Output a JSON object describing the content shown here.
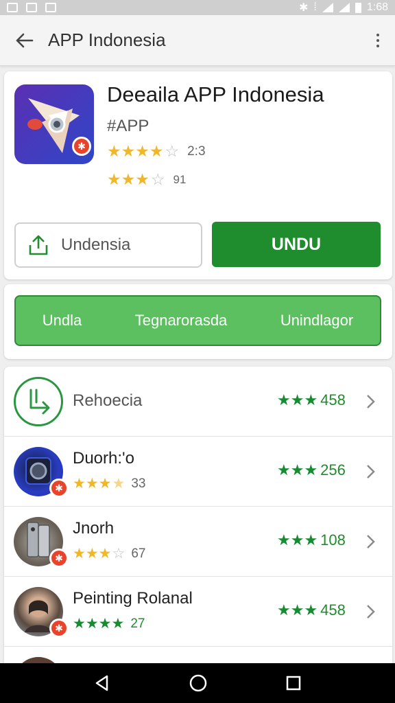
{
  "status_bar": {
    "time": "1:68"
  },
  "app_bar": {
    "title": "APP Indonesia"
  },
  "app": {
    "name": "Deeaila APP Indonesia",
    "subtitle": "#APP",
    "rating1": {
      "stars": "★★★★",
      "empty": "☆",
      "count": "2:3"
    },
    "rating2": {
      "stars": "★★★",
      "empty": "☆",
      "count": "91"
    },
    "secondary_button": "Undensia",
    "primary_button": "UNDU"
  },
  "tabs": [
    "Undla",
    "Tegnarorasda",
    "Unindlagor"
  ],
  "list": [
    {
      "name": "Rehoecia",
      "rating_stars": "★★★",
      "rating_value": "458"
    },
    {
      "name": "Duorh:'o",
      "sub_stars": "★★★",
      "sub_half": "★",
      "sub_empty": "",
      "sub_count": "33",
      "rating_stars": "★★★",
      "rating_value": "256"
    },
    {
      "name": "Jnorh",
      "sub_stars": "★★★",
      "sub_half": "",
      "sub_empty": "☆",
      "sub_count": "67",
      "rating_stars": "★★★",
      "rating_value": "108"
    },
    {
      "name": "Peinting Rolanal",
      "sub_stars": "★★★★",
      "sub_half": "",
      "sub_empty": "",
      "sub_count": "27",
      "rating_stars": "★★★",
      "rating_value": "458"
    }
  ],
  "colors": {
    "primary_green": "#1f8c2d",
    "tab_green": "#5cc060",
    "star_gold": "#f0b72a"
  }
}
